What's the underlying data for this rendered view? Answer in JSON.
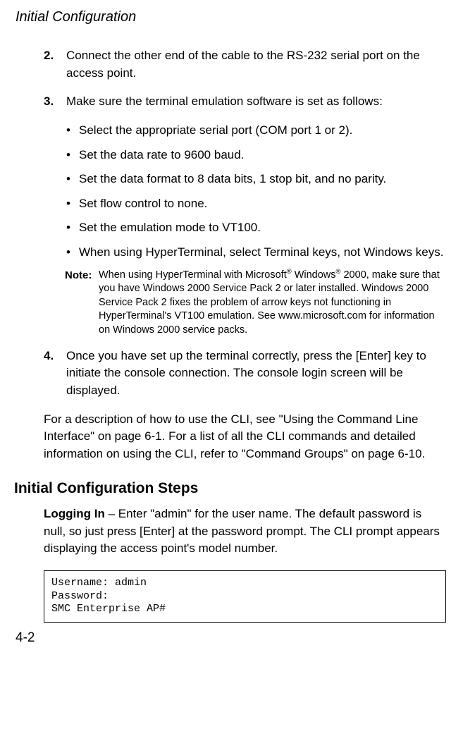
{
  "running_header": "Initial Configuration",
  "steps": {
    "s2": {
      "num": "2.",
      "text": "Connect the other end of the cable to the RS-232 serial port on the access point."
    },
    "s3": {
      "num": "3.",
      "text": "Make sure the terminal emulation software is set as follows:"
    },
    "s4": {
      "num": "4.",
      "text": "Once you have set up the terminal correctly, press the [Enter] key to initiate the console connection. The console login screen will be displayed."
    }
  },
  "bullets": {
    "b1": "Select the appropriate serial port (COM port 1 or 2).",
    "b2": "Set the data rate to 9600 baud.",
    "b3": "Set the data format to 8 data bits, 1 stop bit, and no parity.",
    "b4": "Set flow control to none.",
    "b5": "Set the emulation mode to VT100.",
    "b6": "When using HyperTerminal, select Terminal keys, not Windows keys."
  },
  "note": {
    "label": "Note:",
    "pre": "When using HyperTerminal with Microsoft",
    "mid": " Windows",
    "post": " 2000, make sure that you have Windows 2000 Service Pack 2 or later installed. Windows 2000 Service Pack 2 fixes the problem of arrow keys not functioning in HyperTerminal's VT100 emulation. See www.microsoft.com for information on Windows 2000 service packs."
  },
  "cli_para": "For a description of how to use the CLI, see \"Using the Command Line Interface\" on page 6-1. For a list of all the CLI commands and detailed information on using the CLI, refer to \"Command Groups\" on page 6-10.",
  "section_heading": "Initial Configuration Steps",
  "logging_in": {
    "label": "Logging In",
    "text": " – Enter \"admin\" for the user name. The default password is null, so just press [Enter] at the password prompt. The CLI prompt appears displaying the access point's model number."
  },
  "terminal": "Username: admin\nPassword:\nSMC Enterprise AP#",
  "page_number": "4-2",
  "reg_mark": "®"
}
